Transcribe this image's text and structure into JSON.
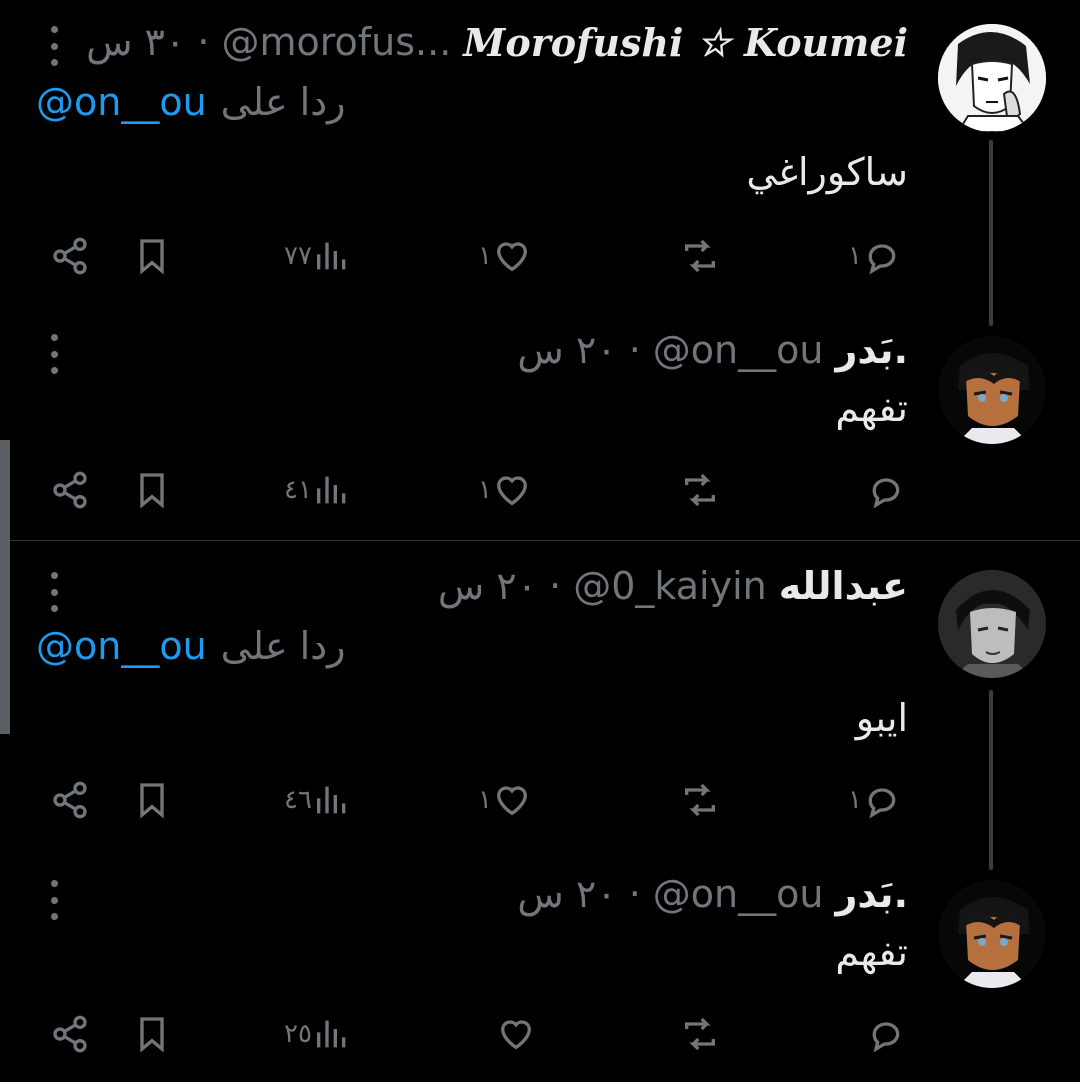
{
  "tweets": [
    {
      "name": "Morofushi ☆ Koumei",
      "handle": "@morofus...",
      "separator": "·",
      "time": "٣٠ س",
      "replying_text": "ردا على",
      "replying_handle": "@on__ou",
      "text": "ساكوراغي",
      "replies": "١",
      "retweets": "",
      "likes": "١",
      "views": "٧٧"
    },
    {
      "name": "بَدر.",
      "handle": "@on__ou",
      "separator": "·",
      "time": "٢٠ س",
      "text": "تفهم",
      "replies": "",
      "retweets": "",
      "likes": "١",
      "views": "٤١"
    },
    {
      "name": "عبدالله",
      "handle": "@0_kaiyin",
      "separator": "·",
      "time": "٢٠ س",
      "replying_text": "ردا على",
      "replying_handle": "@on__ou",
      "text": "ايبو",
      "replies": "١",
      "retweets": "",
      "likes": "١",
      "views": "٤٦"
    },
    {
      "name": "بَدر.",
      "handle": "@on__ou",
      "separator": "·",
      "time": "٢٠ س",
      "text": "تفهم",
      "replies": "",
      "retweets": "",
      "likes": "",
      "views": "٢٥"
    }
  ],
  "colors": {
    "background": "#000000",
    "text": "#e7e9ea",
    "muted": "#71767b",
    "link": "#1d9bf0",
    "divider": "#2f3336"
  },
  "icons": [
    "more-icon",
    "reply-icon",
    "retweet-icon",
    "like-icon",
    "views-icon",
    "bookmark-icon",
    "share-icon"
  ]
}
